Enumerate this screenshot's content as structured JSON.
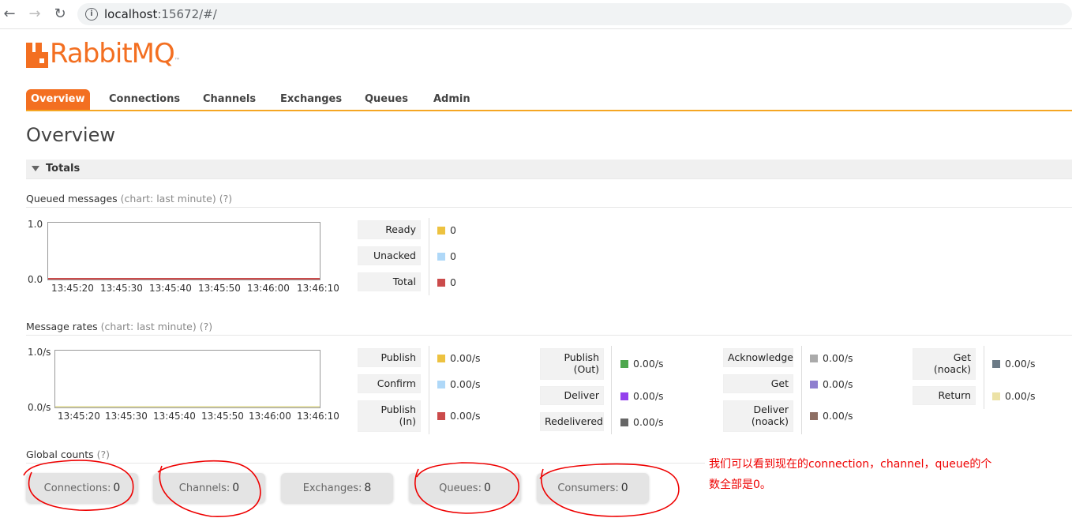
{
  "browser": {
    "back_icon": "arrow-left-icon",
    "forward_icon": "arrow-right-icon",
    "reload_icon": "reload-icon",
    "url_host": "localhost",
    "url_rest": ":15672/#/"
  },
  "app": {
    "logo_text": "RabbitMQ",
    "logo_tm": "™",
    "accent": "#f36f21"
  },
  "nav": {
    "tabs": [
      {
        "label": "Overview",
        "active": true
      },
      {
        "label": "Connections"
      },
      {
        "label": "Channels"
      },
      {
        "label": "Exchanges"
      },
      {
        "label": "Queues"
      },
      {
        "label": "Admin"
      }
    ]
  },
  "page_title": "Overview",
  "totals": {
    "label": "Totals"
  },
  "queued": {
    "title": "Queued messages",
    "chart_note": "(chart: last minute)",
    "help": "(?)",
    "y_top": "1.0",
    "y_bottom": "0.0",
    "x_ticks": [
      "13:45:20",
      "13:45:30",
      "13:45:40",
      "13:45:50",
      "13:46:00",
      "13:46:10"
    ],
    "items": [
      {
        "label": "Ready",
        "value": "0",
        "color": "#edc240"
      },
      {
        "label": "Unacked",
        "value": "0",
        "color": "#afd8f8"
      },
      {
        "label": "Total",
        "value": "0",
        "color": "#cb4b4b"
      }
    ]
  },
  "rates": {
    "title": "Message rates",
    "chart_note": "(chart: last minute)",
    "help": "(?)",
    "y_top": "1.0/s",
    "y_bottom": "0.0/s",
    "x_ticks": [
      "13:45:20",
      "13:45:30",
      "13:45:40",
      "13:45:50",
      "13:46:00",
      "13:46:10"
    ],
    "col1": [
      {
        "label": "Publish",
        "value": "0.00/s",
        "color": "#edc240"
      },
      {
        "label": "Confirm",
        "value": "0.00/s",
        "color": "#afd8f8"
      },
      {
        "label_line1": "Publish",
        "label_line2": "(In)",
        "value": "0.00/s",
        "color": "#cb4b4b"
      }
    ],
    "col2": [
      {
        "label_line1": "Publish",
        "label_line2": "(Out)",
        "value": "0.00/s",
        "color": "#4da74d"
      },
      {
        "label": "Deliver",
        "value": "0.00/s",
        "color": "#9440ed"
      },
      {
        "label": "Redelivered",
        "value": "0.00/s",
        "color": "#666666"
      }
    ],
    "col3": [
      {
        "label": "Acknowledge",
        "value": "0.00/s",
        "color": "#aaaaaa"
      },
      {
        "label": "Get",
        "value": "0.00/s",
        "color": "#8f7fcf"
      },
      {
        "label_line1": "Deliver",
        "label_line2": "(noack)",
        "value": "0.00/s",
        "color": "#8d6e63"
      }
    ],
    "col4": [
      {
        "label_line1": "Get",
        "label_line2": "(noack)",
        "value": "0.00/s",
        "color": "#6b7a86"
      },
      {
        "label": "Return",
        "value": "0.00/s",
        "color": "#ece2a6"
      }
    ]
  },
  "global_counts": {
    "title": "Global counts",
    "help": "(?)",
    "items": [
      {
        "label": "Connections:",
        "value": "0"
      },
      {
        "label": "Channels:",
        "value": "0"
      },
      {
        "label": "Exchanges:",
        "value": "8"
      },
      {
        "label": "Queues:",
        "value": "0"
      },
      {
        "label": "Consumers:",
        "value": "0"
      }
    ]
  },
  "annotation": {
    "line1": "我们可以看到现在的connection，channel，queue的个",
    "line2": "数全部是0。",
    "color": "#e00000"
  }
}
